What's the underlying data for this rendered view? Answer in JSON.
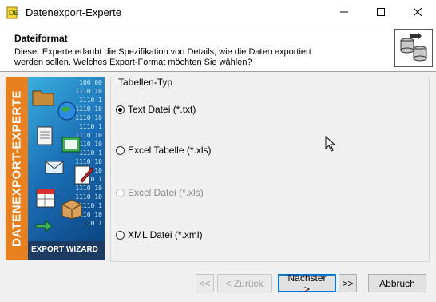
{
  "window": {
    "title": "Datenexport-Experte",
    "minimize_icon": "minimize-icon",
    "maximize_icon": "maximize-icon",
    "close_icon": "close-icon"
  },
  "header": {
    "title": "Dateiformat",
    "description": "Dieser Experte erlaubt die Spezifikation von Details, wie die Daten exportiert werden sollen. Welches Export-Format möchten Sie wählen?",
    "icon": "database-export-icon"
  },
  "banner": {
    "vertical_text": "DATENEXPORT-EXPERTE",
    "bottom_label": "EXPORT WIZARD",
    "binary_text": "100 00\n1110 10\n1110 1\n1110 10\n1110 10\n1110 1\n1110 10\n1110 10\n1110 1\n1110 10\n1110 10\n1110 1\n1110 10\n1110 10\n1110 1\n1110 10\n110 1"
  },
  "group": {
    "title": "Tabellen-Typ",
    "options": [
      {
        "label": "Text Datei (*.txt)",
        "checked": true,
        "disabled": false
      },
      {
        "label": "Excel Tabelle (*.xls)",
        "checked": false,
        "disabled": false
      },
      {
        "label": "Excel Datei (*.xls)",
        "checked": false,
        "disabled": true
      },
      {
        "label": "XML Datei (*.xml)",
        "checked": false,
        "disabled": false
      }
    ]
  },
  "buttons": {
    "first": "<<",
    "back": "< Zurück",
    "next": "Nächster >",
    "last": ">>",
    "cancel": "Abbruch"
  }
}
